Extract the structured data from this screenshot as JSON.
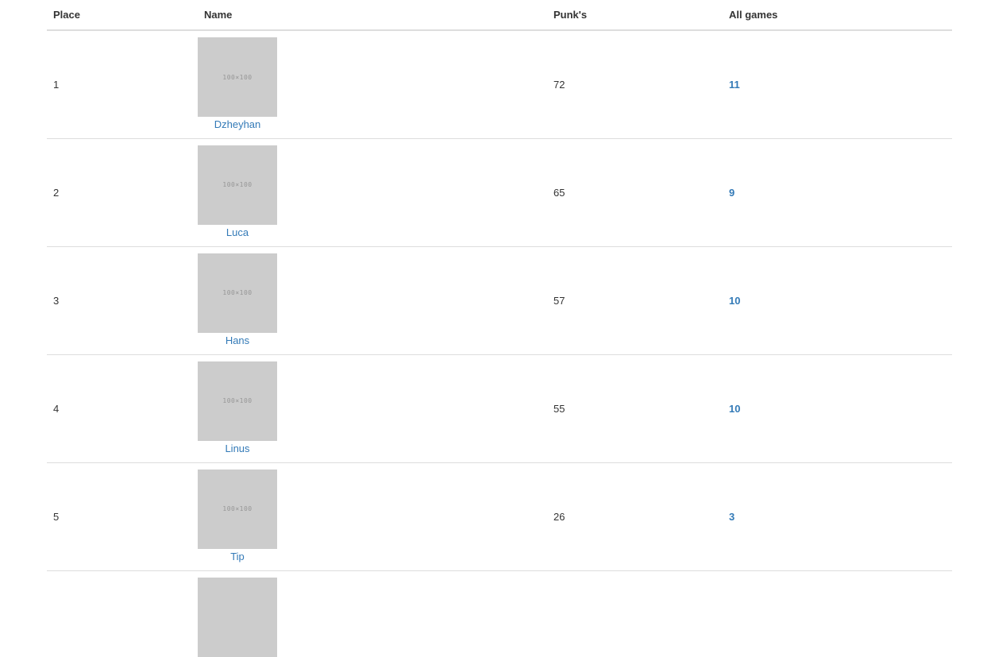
{
  "table": {
    "headers": {
      "place": "Place",
      "name": "Name",
      "points": "Punk's",
      "games": "All games"
    },
    "rows": [
      {
        "place": "1",
        "avatar_text": "100×100",
        "name": "Dzheyhan",
        "points": "72",
        "games": "11"
      },
      {
        "place": "2",
        "avatar_text": "100×100",
        "name": "Luca",
        "points": "65",
        "games": "9"
      },
      {
        "place": "3",
        "avatar_text": "100×100",
        "name": "Hans",
        "points": "57",
        "games": "10"
      },
      {
        "place": "4",
        "avatar_text": "100×100",
        "name": "Linus",
        "points": "55",
        "games": "10"
      },
      {
        "place": "5",
        "avatar_text": "100×100",
        "name": "Tip",
        "points": "26",
        "games": "3"
      }
    ]
  },
  "colors": {
    "link": "#337ab7",
    "avatar_placeholder": "#cccccc",
    "border": "#dddddd",
    "text": "#333333"
  }
}
